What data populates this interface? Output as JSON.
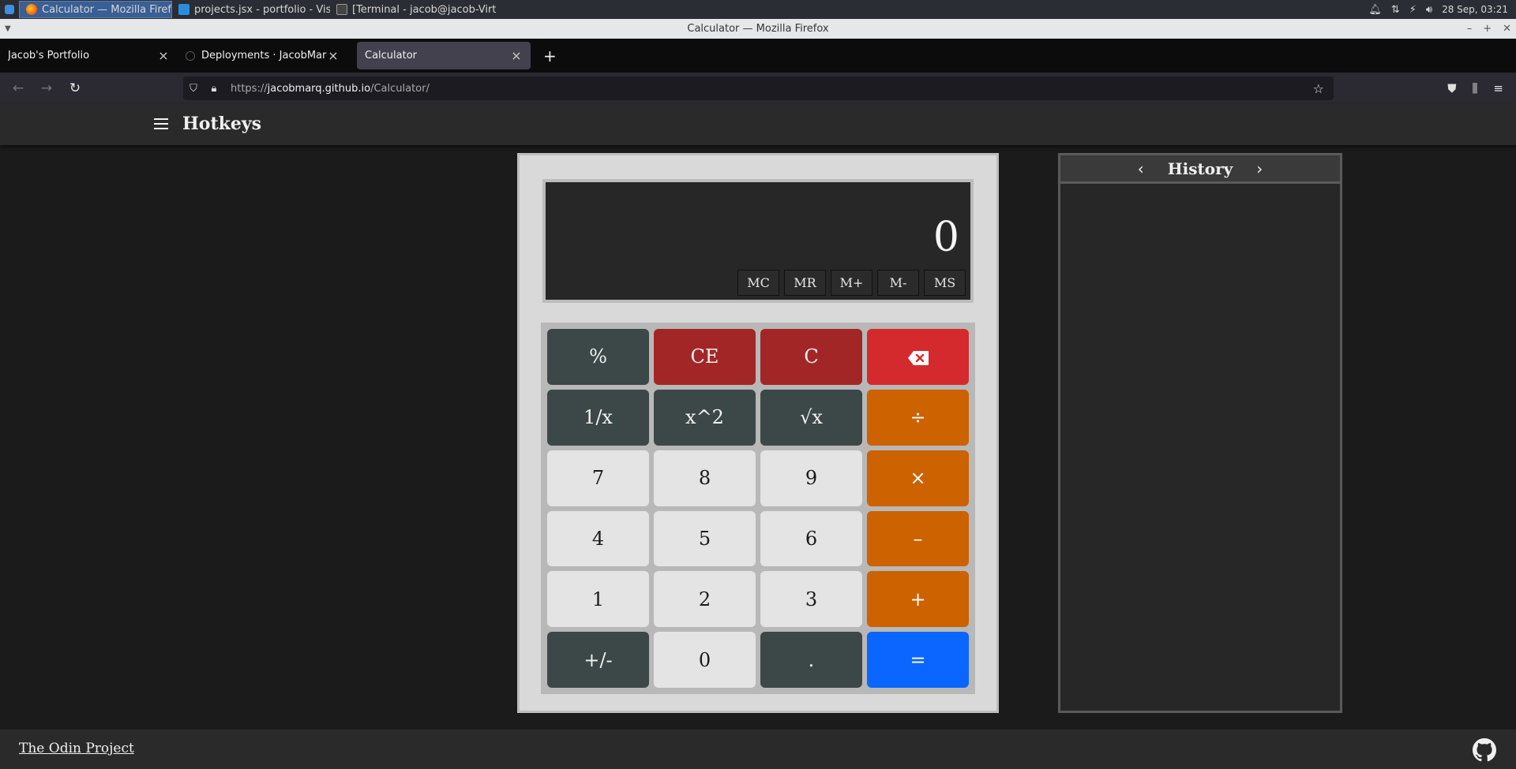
{
  "taskbar": {
    "items": [
      {
        "label": "Calculator — Mozilla Firefox"
      },
      {
        "label": "projects.jsx - portfolio - Visua..."
      },
      {
        "label": "[Terminal - jacob@jacob-Virt..."
      }
    ],
    "clock": "28 Sep, 03:21"
  },
  "window": {
    "title": "Calculator — Mozilla Firefox"
  },
  "tabs": [
    {
      "label": "Jacob's Portfolio"
    },
    {
      "label": "Deployments · JacobMarq/Cal"
    },
    {
      "label": "Calculator"
    }
  ],
  "url": {
    "prefix": "https://",
    "domain": "jacobmarq.github.io",
    "path": "/Calculator/"
  },
  "header": {
    "title": "Hotkeys"
  },
  "calculator": {
    "display_value": "0",
    "memory_buttons": [
      "MC",
      "MR",
      "M+",
      "M-",
      "MS"
    ],
    "keys": {
      "percent": "%",
      "ce": "CE",
      "c": "C",
      "reciprocal": "1/x",
      "square": "x^2",
      "sqrt": "√x",
      "divide": "÷",
      "seven": "7",
      "eight": "8",
      "nine": "9",
      "multiply": "×",
      "four": "4",
      "five": "5",
      "six": "6",
      "minus": "–",
      "one": "1",
      "two": "2",
      "three": "3",
      "plus": "+",
      "negate": "+/-",
      "zero": "0",
      "decimal": ".",
      "equals": "="
    }
  },
  "history": {
    "title": "History"
  },
  "footer": {
    "link": "The Odin Project"
  }
}
